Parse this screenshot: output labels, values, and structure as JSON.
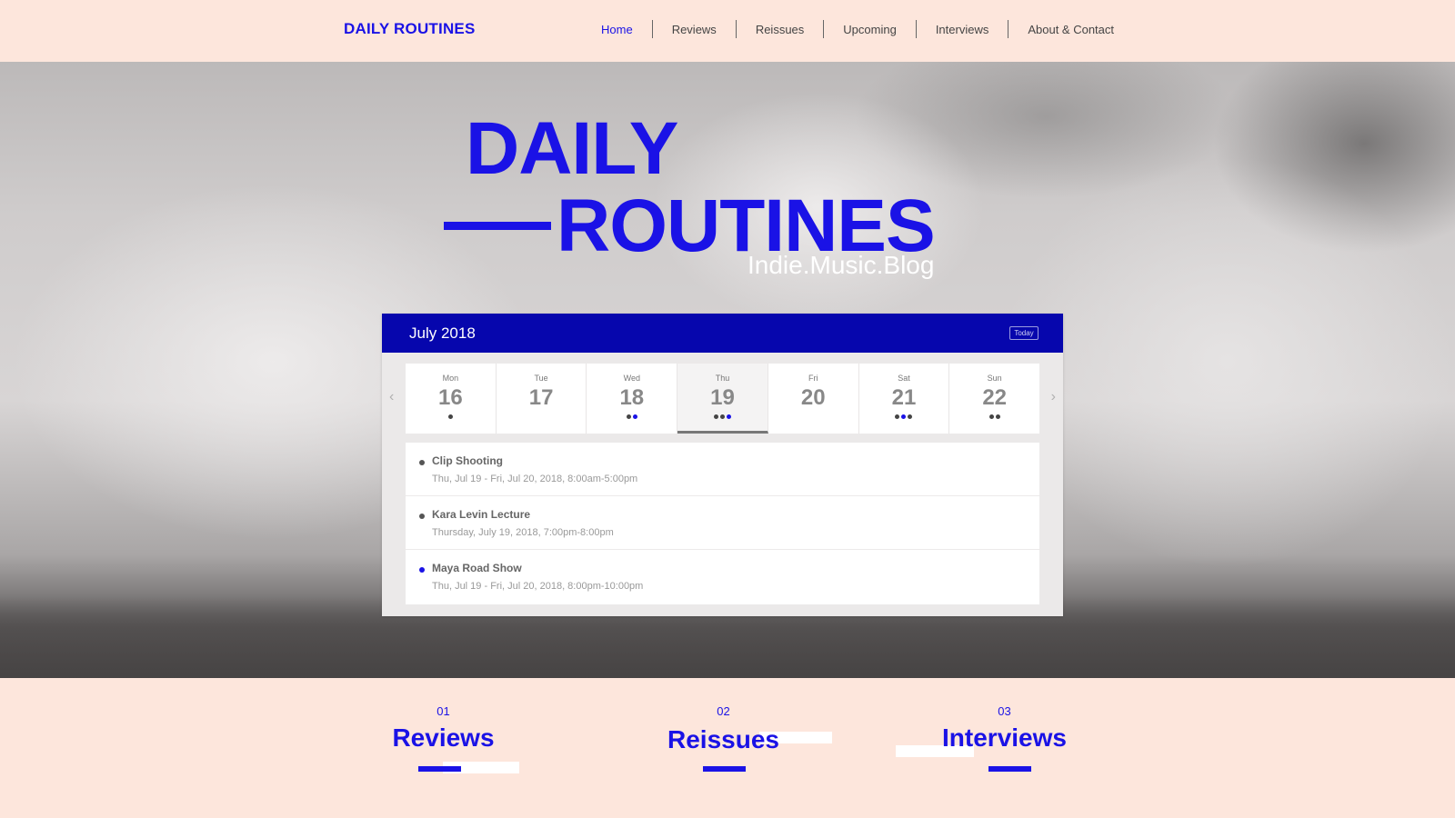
{
  "header": {
    "logo": "DAILY ROUTINES",
    "nav": [
      {
        "label": "Home",
        "active": true
      },
      {
        "label": "Reviews",
        "active": false
      },
      {
        "label": "Reissues",
        "active": false
      },
      {
        "label": "Upcoming",
        "active": false
      },
      {
        "label": "Interviews",
        "active": false
      },
      {
        "label": "About & Contact",
        "active": false
      }
    ]
  },
  "hero": {
    "title_line1": "DAILY",
    "title_line2": "ROUTINES",
    "tagline": "Indie.Music.Blog"
  },
  "calendar": {
    "month_label": "July 2018",
    "today_label": "Today",
    "prev_icon": "‹",
    "next_icon": "›",
    "days": [
      {
        "name": "Mon",
        "num": "16",
        "dots": [
          "dark"
        ]
      },
      {
        "name": "Tue",
        "num": "17",
        "dots": []
      },
      {
        "name": "Wed",
        "num": "18",
        "dots": [
          "dark",
          "blue"
        ]
      },
      {
        "name": "Thu",
        "num": "19",
        "dots": [
          "dark",
          "dark",
          "blue"
        ],
        "selected": true
      },
      {
        "name": "Fri",
        "num": "20",
        "dots": []
      },
      {
        "name": "Sat",
        "num": "21",
        "dots": [
          "dark",
          "blue",
          "dark"
        ]
      },
      {
        "name": "Sun",
        "num": "22",
        "dots": [
          "dark",
          "dark"
        ]
      }
    ],
    "events": [
      {
        "title": "Clip Shooting",
        "time": "Thu, Jul 19 - Fri, Jul 20, 2018, 8:00am-5:00pm",
        "color": "dark"
      },
      {
        "title": "Kara Levin Lecture",
        "time": "Thursday, July 19, 2018, 7:00pm-8:00pm",
        "color": "dark"
      },
      {
        "title": "Maya Road Show",
        "time": "Thu, Jul 19 - Fri, Jul 20, 2018, 8:00pm-10:00pm",
        "color": "blue"
      }
    ]
  },
  "sections": [
    {
      "num": "01",
      "title": "Reviews"
    },
    {
      "num": "02",
      "title": "Reissues"
    },
    {
      "num": "03",
      "title": "Interviews"
    }
  ],
  "colors": {
    "accent": "#1a12e6",
    "calendar_header": "#0606ad",
    "background": "#fde6dc"
  }
}
